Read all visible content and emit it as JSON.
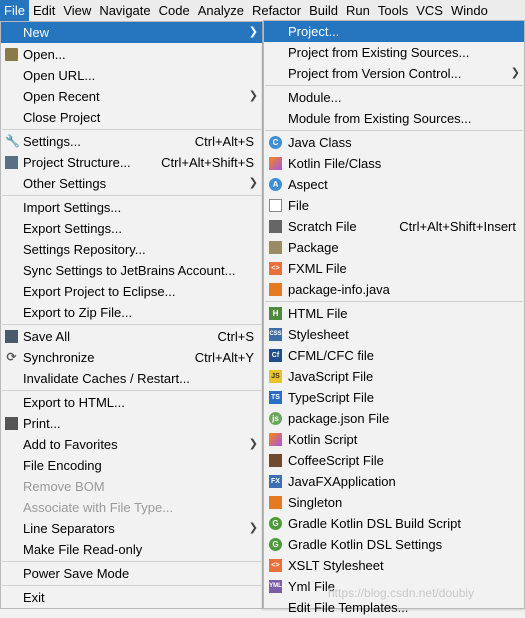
{
  "menubar": [
    "File",
    "Edit",
    "View",
    "Navigate",
    "Code",
    "Analyze",
    "Refactor",
    "Build",
    "Run",
    "Tools",
    "VCS",
    "Windo"
  ],
  "file_menu": {
    "new": "New",
    "open": "Open...",
    "open_url": "Open URL...",
    "open_recent": "Open Recent",
    "close_project": "Close Project",
    "settings": "Settings...",
    "settings_sc": "Ctrl+Alt+S",
    "project_structure": "Project Structure...",
    "project_structure_sc": "Ctrl+Alt+Shift+S",
    "other_settings": "Other Settings",
    "import_settings": "Import Settings...",
    "export_settings": "Export Settings...",
    "settings_repository": "Settings Repository...",
    "sync_settings": "Sync Settings to JetBrains Account...",
    "export_eclipse": "Export Project to Eclipse...",
    "export_zip": "Export to Zip File...",
    "save_all": "Save All",
    "save_all_sc": "Ctrl+S",
    "synchronize": "Synchronize",
    "synchronize_sc": "Ctrl+Alt+Y",
    "invalidate_caches": "Invalidate Caches / Restart...",
    "export_html": "Export to HTML...",
    "print": "Print...",
    "add_favorites": "Add to Favorites",
    "file_encoding": "File Encoding",
    "remove_bom": "Remove BOM",
    "associate_file_type": "Associate with File Type...",
    "line_separators": "Line Separators",
    "make_readonly": "Make File Read-only",
    "power_save": "Power Save Mode",
    "exit": "Exit"
  },
  "new_menu": {
    "project": "Project...",
    "project_existing": "Project from Existing Sources...",
    "project_vcs": "Project from Version Control...",
    "module": "Module...",
    "module_existing": "Module from Existing Sources...",
    "java_class": "Java Class",
    "kotlin_class": "Kotlin File/Class",
    "aspect": "Aspect",
    "file": "File",
    "scratch_file": "Scratch File",
    "scratch_file_sc": "Ctrl+Alt+Shift+Insert",
    "package": "Package",
    "fxml_file": "FXML File",
    "package_info": "package-info.java",
    "html_file": "HTML File",
    "stylesheet": "Stylesheet",
    "cfml_file": "CFML/CFC file",
    "javascript_file": "JavaScript File",
    "typescript_file": "TypeScript File",
    "package_json": "package.json File",
    "kotlin_script": "Kotlin Script",
    "coffeescript_file": "CoffeeScript File",
    "javafx_app": "JavaFXApplication",
    "singleton": "Singleton",
    "gradle_kotlin_build": "Gradle Kotlin DSL Build Script",
    "gradle_kotlin_settings": "Gradle Kotlin DSL Settings",
    "xslt_stylesheet": "XSLT Stylesheet",
    "yml_file": "Yml File",
    "edit_templates": "Edit File Templates..."
  },
  "watermark": "https://blog.csdn.net/doubiy",
  "colors": {
    "selection": "#2675bf",
    "menu_bg": "#f2f2f2"
  }
}
